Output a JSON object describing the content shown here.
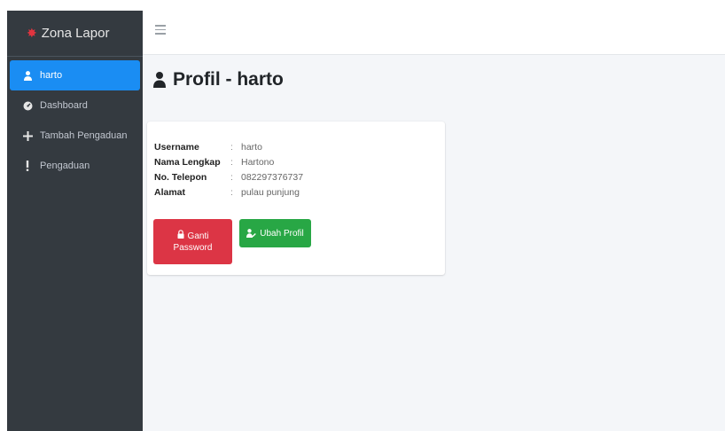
{
  "brand": {
    "name": "Zona Lapor",
    "logo_glyph": "✸"
  },
  "sidebar": {
    "items": [
      {
        "label": "harto",
        "icon": "user-icon",
        "active": true
      },
      {
        "label": "Dashboard",
        "icon": "dashboard-icon",
        "active": false
      },
      {
        "label": "Tambah Pengaduan",
        "icon": "plus-icon",
        "active": false
      },
      {
        "label": "Pengaduan",
        "icon": "exclamation-icon",
        "active": false
      }
    ]
  },
  "topbar": {
    "menu_icon": "hamburger-icon"
  },
  "page": {
    "title": "Profil - harto"
  },
  "profile": {
    "fields": [
      {
        "label": "Username",
        "sep": ":",
        "value": "harto"
      },
      {
        "label": "Nama Lengkap",
        "sep": ":",
        "value": "Hartono"
      },
      {
        "label": "No. Telepon",
        "sep": ":",
        "value": "082297376737"
      },
      {
        "label": "Alamat",
        "sep": ":",
        "value": "pulau punjung"
      }
    ],
    "buttons": {
      "change_password_line1": "Ganti",
      "change_password_line2": "Password",
      "edit_profile": "Ubah Profil"
    }
  },
  "colors": {
    "sidebar_bg": "#343a40",
    "active_item": "#1a8df3",
    "danger": "#dc3545",
    "success": "#28a745",
    "content_bg": "#f4f6f9"
  }
}
